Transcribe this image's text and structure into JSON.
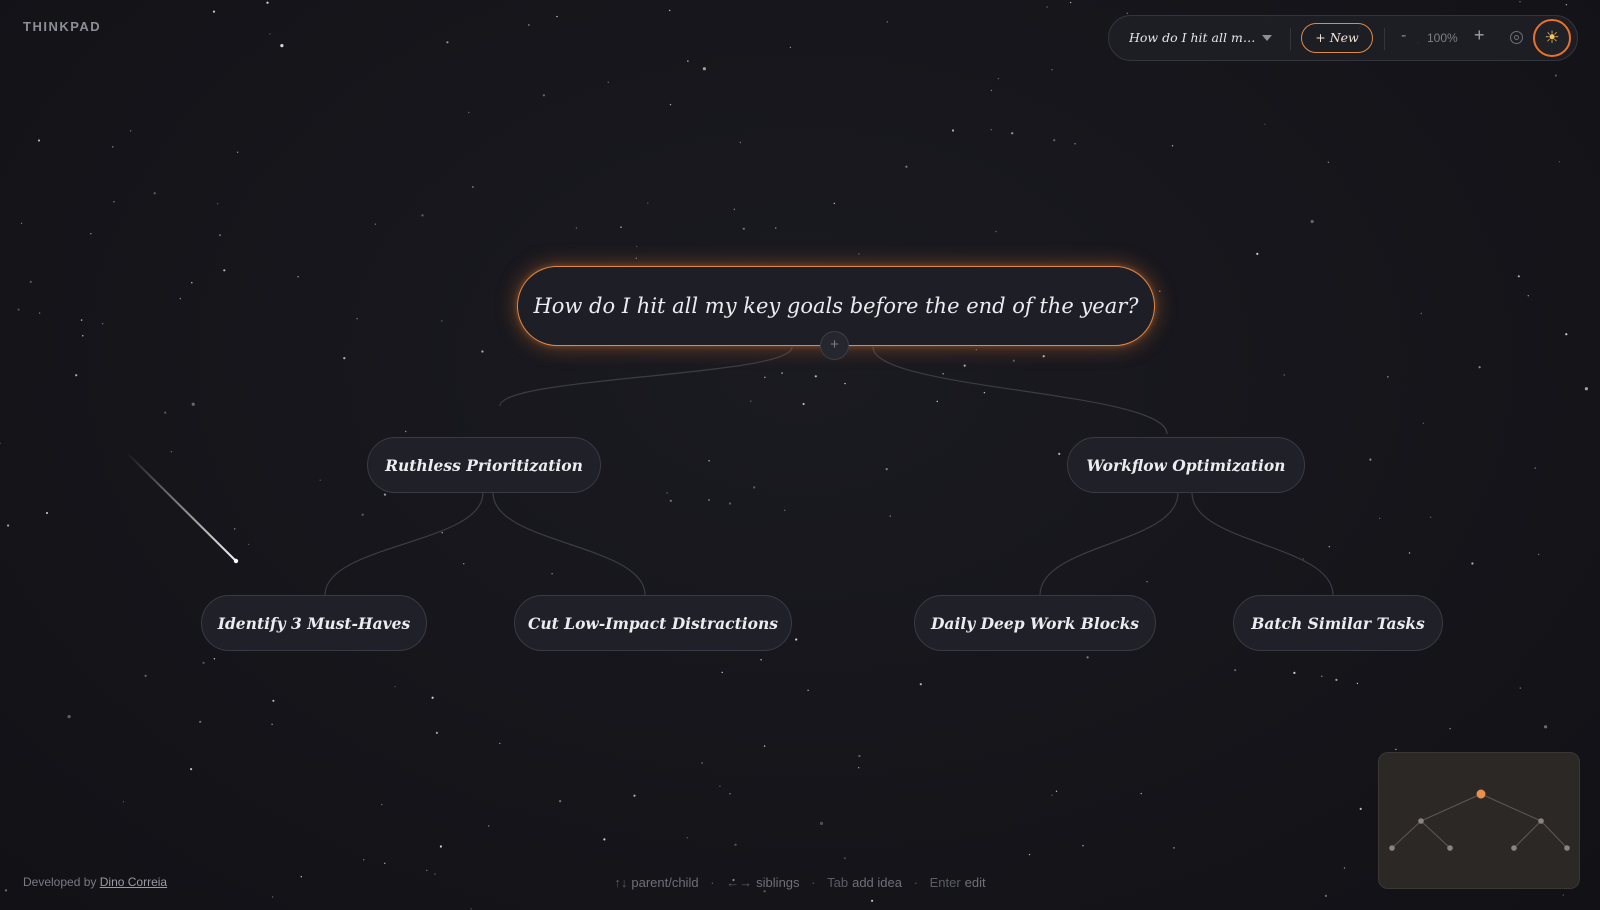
{
  "app": {
    "brand": "THINKPAD"
  },
  "toolbar": {
    "map_title": "How do I hit all my key goals before the end of the year?",
    "new_label": "+ New",
    "zoom_out_label": "-",
    "zoom_level": "100%",
    "zoom_in_label": "+",
    "fit_icon": "target-icon",
    "theme_icon": "sun-icon",
    "theme_glyph": "☀",
    "accent": "#e8722a"
  },
  "mindmap": {
    "root": {
      "label": "How do I hit all my key goals before the end of the year?",
      "add_label": "+"
    },
    "branches": [
      {
        "label": "Ruthless Prioritization",
        "children": [
          "Identify 3 Must-Haves",
          "Cut Low-Impact Distractions"
        ]
      },
      {
        "label": "Workflow Optimization",
        "children": [
          "Daily Deep Work Blocks",
          "Batch Similar Tasks"
        ]
      }
    ]
  },
  "footer": {
    "credit_prefix": "Developed by",
    "credit_name": "Dino Correia",
    "hints": [
      {
        "keys": "↑↓",
        "action": "parent/child"
      },
      {
        "keys": "←→",
        "action": "siblings"
      },
      {
        "keys": "Tab",
        "action": "add idea"
      },
      {
        "keys": "Enter",
        "action": "edit"
      }
    ]
  }
}
